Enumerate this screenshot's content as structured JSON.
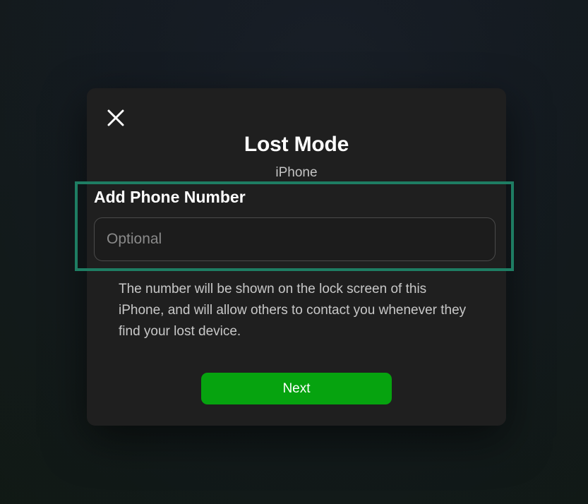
{
  "modal": {
    "title": "Lost Mode",
    "device_name": "iPhone",
    "close_icon": "close-icon",
    "phone_field": {
      "label": "Add Phone Number",
      "value": "",
      "placeholder": "Optional"
    },
    "helper_text": "The number will be shown on the lock screen of this iPhone, and will allow others to contact you whenever they find your lost device.",
    "next_label": "Next"
  },
  "colors": {
    "accent_green": "#06a30f",
    "highlight_border": "#1e7d63",
    "modal_background": "#1f1f1f"
  }
}
